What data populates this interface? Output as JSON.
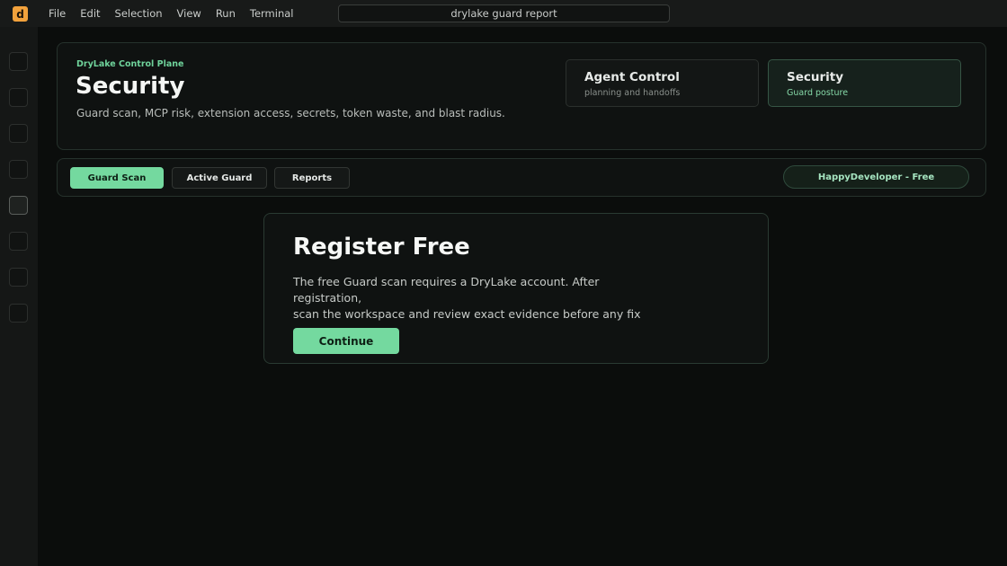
{
  "app": {
    "logo_letter": "d",
    "brand_color": "#f2a23c",
    "accent_color": "#74d99f"
  },
  "menu": [
    "File",
    "Edit",
    "Selection",
    "View",
    "Run",
    "Terminal"
  ],
  "command_search": {
    "text": "drylake guard report"
  },
  "activity_bar": {
    "items": [
      "activity-1",
      "activity-2",
      "activity-3",
      "activity-4",
      "activity-5",
      "activity-6",
      "activity-7",
      "activity-8"
    ],
    "active_index": 4
  },
  "header": {
    "eyebrow": "DryLake Control Plane",
    "title": "Security",
    "subtitle": "Guard scan, MCP risk, extension access, secrets, token waste, and blast radius."
  },
  "modes": [
    {
      "title": "Agent Control",
      "subtitle": "planning and handoffs",
      "selected": false
    },
    {
      "title": "Security",
      "subtitle": "Guard posture",
      "selected": true
    }
  ],
  "tabs": [
    {
      "label": "Guard Scan",
      "selected": true
    },
    {
      "label": "Active Guard",
      "selected": false
    },
    {
      "label": "Reports",
      "selected": false
    }
  ],
  "account": {
    "label": "HappyDeveloper - Free"
  },
  "register": {
    "title": "Register Free",
    "body_line1": "The free Guard scan requires a DryLake account. After registration,",
    "body_line2": "scan the workspace and review exact evidence before any fix",
    "button_label": "Continue"
  }
}
